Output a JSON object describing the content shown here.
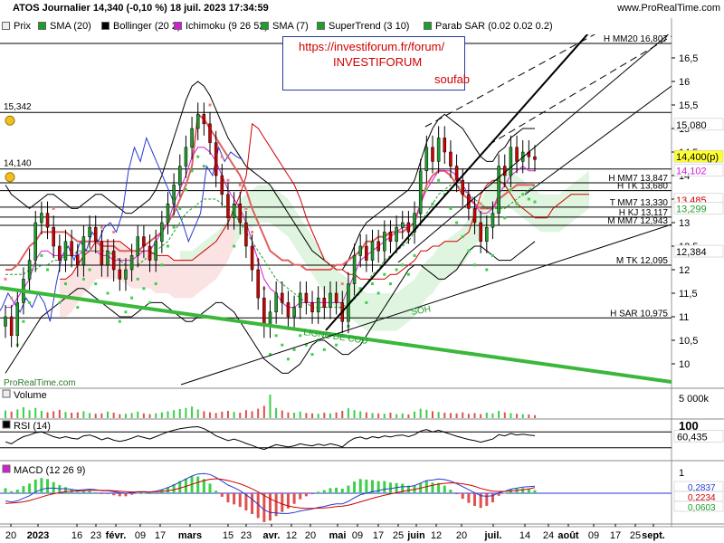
{
  "header": {
    "title": "ATOS Journalier 14,340 (-0,10 %) 18 juil. 2023 17:34:59",
    "site": "www.ProRealTime.com",
    "watermark": "ProRealTime.com"
  },
  "legend": [
    {
      "label": "Prix",
      "color": "#eeeeee"
    },
    {
      "label": "SMA (20)",
      "color": "#1d9e2b"
    },
    {
      "label": "Bollinger (20 2)",
      "color": "#000000"
    },
    {
      "label": "Ichimoku (9 26 52)",
      "color": "#d21fd2"
    },
    {
      "label": "SMA (7)",
      "color": "#1d9e2b"
    },
    {
      "label": "SuperTrend (3 10)",
      "color": "#1d9e2b"
    },
    {
      "label": "Parab SAR (0.02 0.02 0.2)",
      "color": "#1d9e2b"
    }
  ],
  "annotation": {
    "url": "https://investiforum.fr/forum/",
    "name": "INVESTIFORUM",
    "user": "soufab"
  },
  "chart_data": {
    "type": "line",
    "main": {
      "ylim": [
        9.5,
        17
      ],
      "yticks": [
        "16,5",
        "16",
        "15,5",
        "15",
        "14,5",
        "14",
        "13,5",
        "13",
        "12,5",
        "12",
        "11,5",
        "11",
        "10,5",
        "10"
      ],
      "ytick_values": [
        16.5,
        16,
        15.5,
        15,
        14.5,
        14,
        13.5,
        13,
        12.5,
        12,
        11.5,
        11,
        10.5,
        10
      ],
      "price_closes": [
        11.0,
        10.6,
        11.3,
        11.8,
        12.2,
        13.0,
        13.2,
        12.9,
        12.5,
        12.2,
        12.6,
        12.3,
        12.1,
        12.7,
        12.9,
        12.6,
        12.1,
        12.4,
        12.0,
        11.8,
        12.0,
        12.3,
        12.7,
        12.5,
        12.2,
        12.6,
        13.0,
        13.4,
        13.8,
        14.2,
        14.6,
        15.0,
        15.3,
        15.1,
        14.7,
        14.0,
        13.6,
        13.1,
        13.4,
        13.0,
        12.5,
        12.0,
        11.4,
        10.8,
        11.1,
        11.5,
        11.3,
        11.0,
        11.2,
        11.5,
        11.3,
        11.1,
        11.4,
        11.2,
        11.5,
        11.3,
        10.9,
        11.7,
        12.3,
        12.5,
        12.2,
        12.6,
        12.4,
        12.8,
        12.6,
        12.9,
        13.0,
        12.8,
        13.2,
        14.1,
        14.6,
        14.3,
        14.8,
        14.5,
        14.2,
        13.9,
        13.6,
        13.3,
        13.0,
        12.6,
        12.9,
        13.2,
        14.2,
        14.0,
        14.6,
        14.3,
        14.5,
        14.4,
        14.34
      ],
      "bollinger_upper": [
        13.8,
        13.6,
        13.5,
        13.4,
        13.3,
        13.4,
        13.5,
        13.6,
        13.6,
        13.5,
        13.4,
        13.3,
        13.3,
        13.4,
        13.5,
        13.6,
        13.6,
        13.5,
        13.4,
        13.3,
        13.2,
        13.2,
        13.3,
        13.4,
        13.5,
        13.7,
        14.0,
        14.4,
        14.8,
        15.2,
        15.6,
        15.9,
        16.0,
        15.9,
        15.7,
        15.4,
        15.1,
        14.8,
        14.6,
        14.4,
        14.2,
        14.1,
        14.0,
        13.9,
        13.8,
        13.6,
        13.4,
        13.2,
        13.0,
        12.8,
        12.6,
        12.4,
        12.3,
        12.2,
        12.1,
        12.0,
        12.0,
        12.2,
        12.5,
        12.8,
        13.0,
        13.1,
        13.2,
        13.3,
        13.4,
        13.5,
        13.6,
        13.7,
        13.9,
        14.3,
        14.7,
        15.0,
        15.2,
        15.3,
        15.2,
        15.1,
        15.0,
        14.8,
        14.6,
        14.4,
        14.3,
        14.3,
        14.5,
        14.6,
        14.8,
        14.9,
        15.0,
        15.0,
        15.0
      ],
      "bollinger_lower": [
        9.8,
        10.0,
        10.2,
        10.4,
        10.6,
        10.8,
        11.0,
        11.1,
        11.2,
        11.3,
        11.4,
        11.5,
        11.6,
        11.6,
        11.5,
        11.4,
        11.3,
        11.2,
        11.1,
        11.0,
        11.0,
        11.0,
        11.1,
        11.2,
        11.3,
        11.3,
        11.3,
        11.2,
        11.1,
        11.0,
        10.9,
        10.9,
        11.0,
        11.1,
        11.2,
        11.3,
        11.3,
        11.2,
        11.1,
        10.9,
        10.7,
        10.5,
        10.3,
        10.1,
        10.0,
        9.9,
        9.8,
        9.8,
        9.9,
        10.0,
        10.2,
        10.4,
        10.5,
        10.5,
        10.4,
        10.3,
        10.2,
        10.2,
        10.3,
        10.4,
        10.6,
        10.8,
        11.0,
        11.2,
        11.4,
        11.6,
        11.8,
        12.0,
        12.1,
        12.1,
        12.0,
        11.9,
        11.8,
        11.8,
        11.9,
        12.0,
        12.2,
        12.4,
        12.5,
        12.5,
        12.4,
        12.3,
        12.2,
        12.2,
        12.2,
        12.3,
        12.4,
        12.5,
        12.6
      ],
      "sma20": [
        11.9,
        11.9,
        11.9,
        11.9,
        12.0,
        12.0,
        12.1,
        12.1,
        12.2,
        12.2,
        12.3,
        12.3,
        12.4,
        12.4,
        12.4,
        12.4,
        12.4,
        12.4,
        12.3,
        12.2,
        12.1,
        12.1,
        12.1,
        12.2,
        12.3,
        12.4,
        12.5,
        12.6,
        12.8,
        13.0,
        13.2,
        13.3,
        13.4,
        13.5,
        13.5,
        13.5,
        13.4,
        13.3,
        13.2,
        13.0,
        12.8,
        12.6,
        12.4,
        12.2,
        12.0,
        11.8,
        11.7,
        11.6,
        11.5,
        11.4,
        11.3,
        11.2,
        11.2,
        11.2,
        11.2,
        11.2,
        11.2,
        11.3,
        11.4,
        11.5,
        11.7,
        11.9,
        12.0,
        12.2,
        12.3,
        12.4,
        12.5,
        12.6,
        12.8,
        13.0,
        13.2,
        13.4,
        13.6,
        13.7,
        13.8,
        13.8,
        13.7,
        13.6,
        13.5,
        13.4,
        13.3,
        13.3,
        13.3,
        13.3,
        13.4,
        13.5,
        13.6,
        13.7,
        13.8
      ],
      "tenkan_magenta": [
        11.2,
        11.2,
        11.4,
        11.6,
        11.8,
        12.2,
        12.4,
        12.4,
        12.3,
        12.3,
        12.3,
        12.3,
        12.3,
        12.4,
        12.4,
        12.4,
        12.3,
        12.3,
        12.2,
        12.2,
        12.2,
        12.2,
        12.3,
        12.4,
        12.4,
        12.6,
        12.8,
        13.0,
        13.4,
        13.7,
        14.0,
        14.4,
        14.6,
        14.6,
        14.5,
        14.3,
        14.0,
        13.7,
        13.5,
        13.3,
        13.0,
        12.6,
        12.2,
        11.8,
        11.6,
        11.5,
        11.3,
        11.2,
        11.2,
        11.3,
        11.3,
        11.3,
        11.3,
        11.3,
        11.3,
        11.3,
        11.3,
        11.6,
        11.9,
        12.2,
        12.3,
        12.4,
        12.5,
        12.6,
        12.7,
        12.8,
        12.9,
        12.9,
        13.0,
        13.4,
        13.7,
        13.9,
        14.1,
        14.1,
        14.1,
        14.0,
        13.8,
        13.6,
        13.4,
        13.2,
        13.2,
        13.3,
        13.6,
        13.8,
        14.0,
        14.1,
        14.2,
        14.1,
        14.1
      ],
      "kijun_red": [
        12.0,
        12.0,
        12.1,
        12.3,
        12.5,
        12.6,
        12.8,
        12.8,
        12.8,
        12.8,
        12.8,
        12.7,
        12.6,
        12.6,
        12.6,
        12.6,
        12.5,
        12.5,
        12.5,
        12.4,
        12.4,
        12.4,
        12.4,
        12.5,
        12.6,
        12.7,
        12.8,
        13.0,
        13.2,
        13.5,
        13.8,
        14.2,
        15.3,
        15.2,
        15.0,
        14.8,
        14.6,
        14.4,
        14.2,
        14.0,
        13.7,
        13.3,
        13.0,
        12.7,
        12.4,
        12.3,
        12.2,
        12.2,
        12.1,
        12.1,
        12.0,
        12.0,
        12.0,
        12.0,
        12.0,
        12.1,
        12.1,
        12.2,
        12.3,
        12.4,
        12.6,
        12.6,
        12.7,
        12.7,
        12.8,
        12.8,
        12.8,
        12.9,
        13.0,
        13.4,
        13.8,
        14.0,
        14.1,
        14.1,
        14.0,
        13.8,
        13.6,
        13.5,
        13.4,
        13.3,
        13.3,
        13.3,
        13.5,
        13.6,
        13.7,
        13.8,
        13.8,
        13.8,
        13.8
      ],
      "hlines": [
        {
          "label": "15,342",
          "value": 15.342,
          "side": "left"
        },
        {
          "label": "14,140",
          "value": 14.14,
          "side": "left"
        },
        {
          "label": "H MM7 13,847",
          "value": 13.847,
          "side": "right"
        },
        {
          "label": "H TK 13,680",
          "value": 13.68,
          "side": "right"
        },
        {
          "label": "T MM7 13,330",
          "value": 13.33,
          "side": "right"
        },
        {
          "label": "H KJ 13,117",
          "value": 13.117,
          "side": "right"
        },
        {
          "label": "M MM7 12,943",
          "value": 12.943,
          "side": "right"
        },
        {
          "label": "M TK 12,095",
          "value": 12.095,
          "side": "right"
        },
        {
          "label": "H SAR 10,975",
          "value": 10.975,
          "side": "right"
        },
        {
          "label": "H MM20 16,807",
          "value": 16.807,
          "side": "right"
        }
      ],
      "price_tags": [
        {
          "label": "15,080",
          "value": 15.08,
          "color": "#ffffff",
          "text": "#000000"
        },
        {
          "label": "14,400(p)",
          "value": 14.4,
          "color": "#ffff33",
          "text": "#000000"
        },
        {
          "label": "14,102",
          "value": 14.102,
          "color": "#ffffff",
          "text": "#d21fd2"
        },
        {
          "label": "13,485",
          "value": 13.485,
          "color": "#ffffff",
          "text": "#d00000"
        },
        {
          "label": "13,299",
          "value": 13.299,
          "color": "#ffffff",
          "text": "#1d9e2b"
        },
        {
          "label": "12,384",
          "value": 12.384,
          "color": "#ffffff",
          "text": "#000000"
        }
      ],
      "trend_labels": [
        {
          "label": "LIGNE DE COU",
          "color": "#1d9e2b"
        },
        {
          "label": "SOH",
          "color": "#1d9e2b"
        }
      ]
    },
    "volume": {
      "title": "Volume",
      "ytick": "5 000k",
      "values": [
        2.1,
        1.8,
        2.4,
        3.0,
        2.2,
        2.8,
        2.0,
        1.6,
        1.9,
        2.3,
        1.7,
        1.5,
        1.6,
        1.9,
        1.4,
        1.2,
        1.3,
        1.8,
        1.5,
        1.1,
        1.2,
        1.4,
        1.8,
        1.3,
        1.1,
        1.3,
        1.6,
        1.9,
        2.2,
        2.5,
        2.8,
        3.2,
        2.4,
        1.9,
        1.6,
        1.4,
        1.8,
        2.0,
        1.7,
        1.5,
        2.2,
        1.9,
        2.6,
        3.4,
        6.5,
        2.8,
        2.1,
        1.6,
        1.5,
        1.8,
        1.4,
        1.3,
        1.2,
        1.5,
        1.3,
        1.6,
        2.0,
        2.7,
        2.2,
        1.9,
        1.6,
        1.4,
        1.3,
        1.2,
        1.5,
        1.1,
        1.3,
        1.0,
        1.8,
        2.6,
        2.3,
        1.9,
        1.7,
        1.5,
        1.4,
        1.3,
        1.6,
        1.2,
        1.4,
        1.1,
        1.5,
        1.3,
        2.0,
        1.6,
        1.4,
        1.2,
        1.1,
        1.0,
        0.8
      ],
      "ylim": [
        0,
        8
      ]
    },
    "rsi": {
      "title": "RSI (14)",
      "ytick": "100",
      "last_label": "60,435",
      "ylim": [
        0,
        100
      ],
      "values": [
        45,
        40,
        50,
        58,
        62,
        68,
        70,
        64,
        58,
        54,
        58,
        54,
        52,
        60,
        62,
        57,
        50,
        55,
        49,
        46,
        49,
        54,
        60,
        56,
        52,
        58,
        64,
        70,
        74,
        78,
        80,
        82,
        83,
        78,
        70,
        60,
        54,
        48,
        52,
        47,
        41,
        36,
        30,
        26,
        32,
        38,
        35,
        32,
        35,
        40,
        37,
        35,
        39,
        36,
        40,
        37,
        32,
        45,
        54,
        57,
        52,
        58,
        55,
        60,
        57,
        61,
        62,
        58,
        63,
        72,
        76,
        70,
        74,
        69,
        64,
        59,
        55,
        51,
        48,
        44,
        48,
        52,
        63,
        60,
        66,
        62,
        64,
        62,
        60.4
      ]
    },
    "macd": {
      "title": "MACD (12 26 9)",
      "ytick": "1",
      "labels": [
        {
          "label": "0,2837",
          "color": "#2a3ad0"
        },
        {
          "label": "0,2234",
          "color": "#d00000"
        },
        {
          "label": "0,0603",
          "color": "#1d9e2b"
        }
      ],
      "macd_line": [
        -0.3,
        -0.35,
        -0.3,
        -0.2,
        -0.1,
        0.05,
        0.15,
        0.2,
        0.2,
        0.18,
        0.18,
        0.15,
        0.12,
        0.14,
        0.16,
        0.14,
        0.1,
        0.1,
        0.06,
        0.02,
        0.0,
        0.02,
        0.06,
        0.06,
        0.05,
        0.08,
        0.14,
        0.22,
        0.32,
        0.44,
        0.56,
        0.68,
        0.76,
        0.78,
        0.74,
        0.62,
        0.48,
        0.32,
        0.22,
        0.1,
        -0.06,
        -0.24,
        -0.44,
        -0.66,
        -0.76,
        -0.78,
        -0.8,
        -0.8,
        -0.76,
        -0.7,
        -0.66,
        -0.62,
        -0.56,
        -0.52,
        -0.46,
        -0.42,
        -0.42,
        -0.32,
        -0.18,
        -0.06,
        0.0,
        0.06,
        0.1,
        0.16,
        0.18,
        0.22,
        0.26,
        0.26,
        0.3,
        0.4,
        0.5,
        0.52,
        0.56,
        0.54,
        0.48,
        0.38,
        0.26,
        0.14,
        0.02,
        -0.1,
        -0.12,
        -0.1,
        0.02,
        0.08,
        0.16,
        0.2,
        0.24,
        0.26,
        0.28
      ],
      "signal_line": [
        -0.4,
        -0.39,
        -0.37,
        -0.34,
        -0.29,
        -0.22,
        -0.15,
        -0.08,
        -0.02,
        0.02,
        0.06,
        0.08,
        0.09,
        0.1,
        0.11,
        0.12,
        0.11,
        0.11,
        0.1,
        0.08,
        0.06,
        0.05,
        0.05,
        0.05,
        0.05,
        0.06,
        0.07,
        0.1,
        0.14,
        0.2,
        0.27,
        0.35,
        0.43,
        0.5,
        0.55,
        0.57,
        0.55,
        0.5,
        0.44,
        0.37,
        0.28,
        0.17,
        0.05,
        -0.09,
        -0.22,
        -0.33,
        -0.43,
        -0.5,
        -0.55,
        -0.58,
        -0.6,
        -0.6,
        -0.59,
        -0.58,
        -0.56,
        -0.53,
        -0.51,
        -0.47,
        -0.41,
        -0.34,
        -0.27,
        -0.2,
        -0.14,
        -0.08,
        -0.03,
        0.02,
        0.07,
        0.11,
        0.15,
        0.2,
        0.26,
        0.31,
        0.36,
        0.39,
        0.41,
        0.4,
        0.37,
        0.33,
        0.27,
        0.19,
        0.13,
        0.08,
        0.07,
        0.07,
        0.09,
        0.11,
        0.14,
        0.17,
        0.22
      ]
    },
    "xaxis": {
      "labels": [
        "20",
        "2023",
        "16",
        "23",
        "févr.",
        "09",
        "17",
        "mars",
        "15",
        "23",
        "avr.",
        "12",
        "20",
        "mai",
        "09",
        "17",
        "25",
        "juin",
        "12",
        "20",
        "juil.",
        "14",
        "24",
        "août",
        "09",
        "17",
        "25",
        "sept."
      ],
      "bold": [
        "2023",
        "févr.",
        "mars",
        "avr.",
        "mai",
        "juin",
        "juil.",
        "août",
        "sept."
      ]
    }
  }
}
